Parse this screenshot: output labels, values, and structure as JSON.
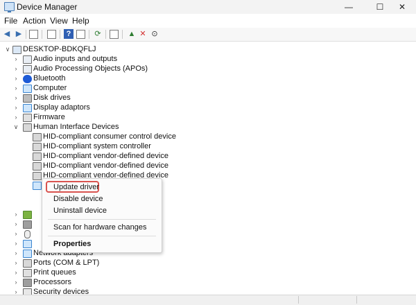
{
  "window": {
    "title": "Device Manager",
    "minimize": "—",
    "maximize": "☐",
    "close": "✕"
  },
  "menu": [
    "File",
    "Action",
    "View",
    "Help"
  ],
  "tree": {
    "root": "DESKTOP-BDKQFLJ",
    "categories_top": [
      {
        "label": "Audio inputs and outputs",
        "icon": "speaker-icon"
      },
      {
        "label": "Audio Processing Objects (APOs)",
        "icon": "speaker-icon"
      },
      {
        "label": "Bluetooth",
        "icon": "bluetooth-icon"
      },
      {
        "label": "Computer",
        "icon": "monitor-icon"
      },
      {
        "label": "Disk drives",
        "icon": "disk-icon"
      },
      {
        "label": "Display adaptors",
        "icon": "display-icon"
      },
      {
        "label": "Firmware",
        "icon": "chip-icon"
      },
      {
        "label": "Human Interface Devices",
        "icon": "hid-icon"
      }
    ],
    "hid_children": [
      "HID-compliant consumer control device",
      "HID-compliant system controller",
      "HID-compliant vendor-defined device",
      "HID-compliant vendor-defined device",
      "HID-compliant vendor-defined device"
    ],
    "categories_bottom": [
      {
        "label": "Network adapters",
        "icon": "network-icon"
      },
      {
        "label": "Ports (COM & LPT)",
        "icon": "port-icon"
      },
      {
        "label": "Print queues",
        "icon": "printer-icon"
      },
      {
        "label": "Processors",
        "icon": "cpu-icon"
      },
      {
        "label": "Security devices",
        "icon": "security-icon"
      }
    ]
  },
  "context_menu": {
    "update": "Update driver",
    "disable": "Disable device",
    "uninstall": "Uninstall device",
    "scan": "Scan for hardware changes",
    "properties": "Properties"
  },
  "colors": {
    "highlight_border": "#d9534f",
    "titlebar_bg": "#f3f3f3"
  }
}
